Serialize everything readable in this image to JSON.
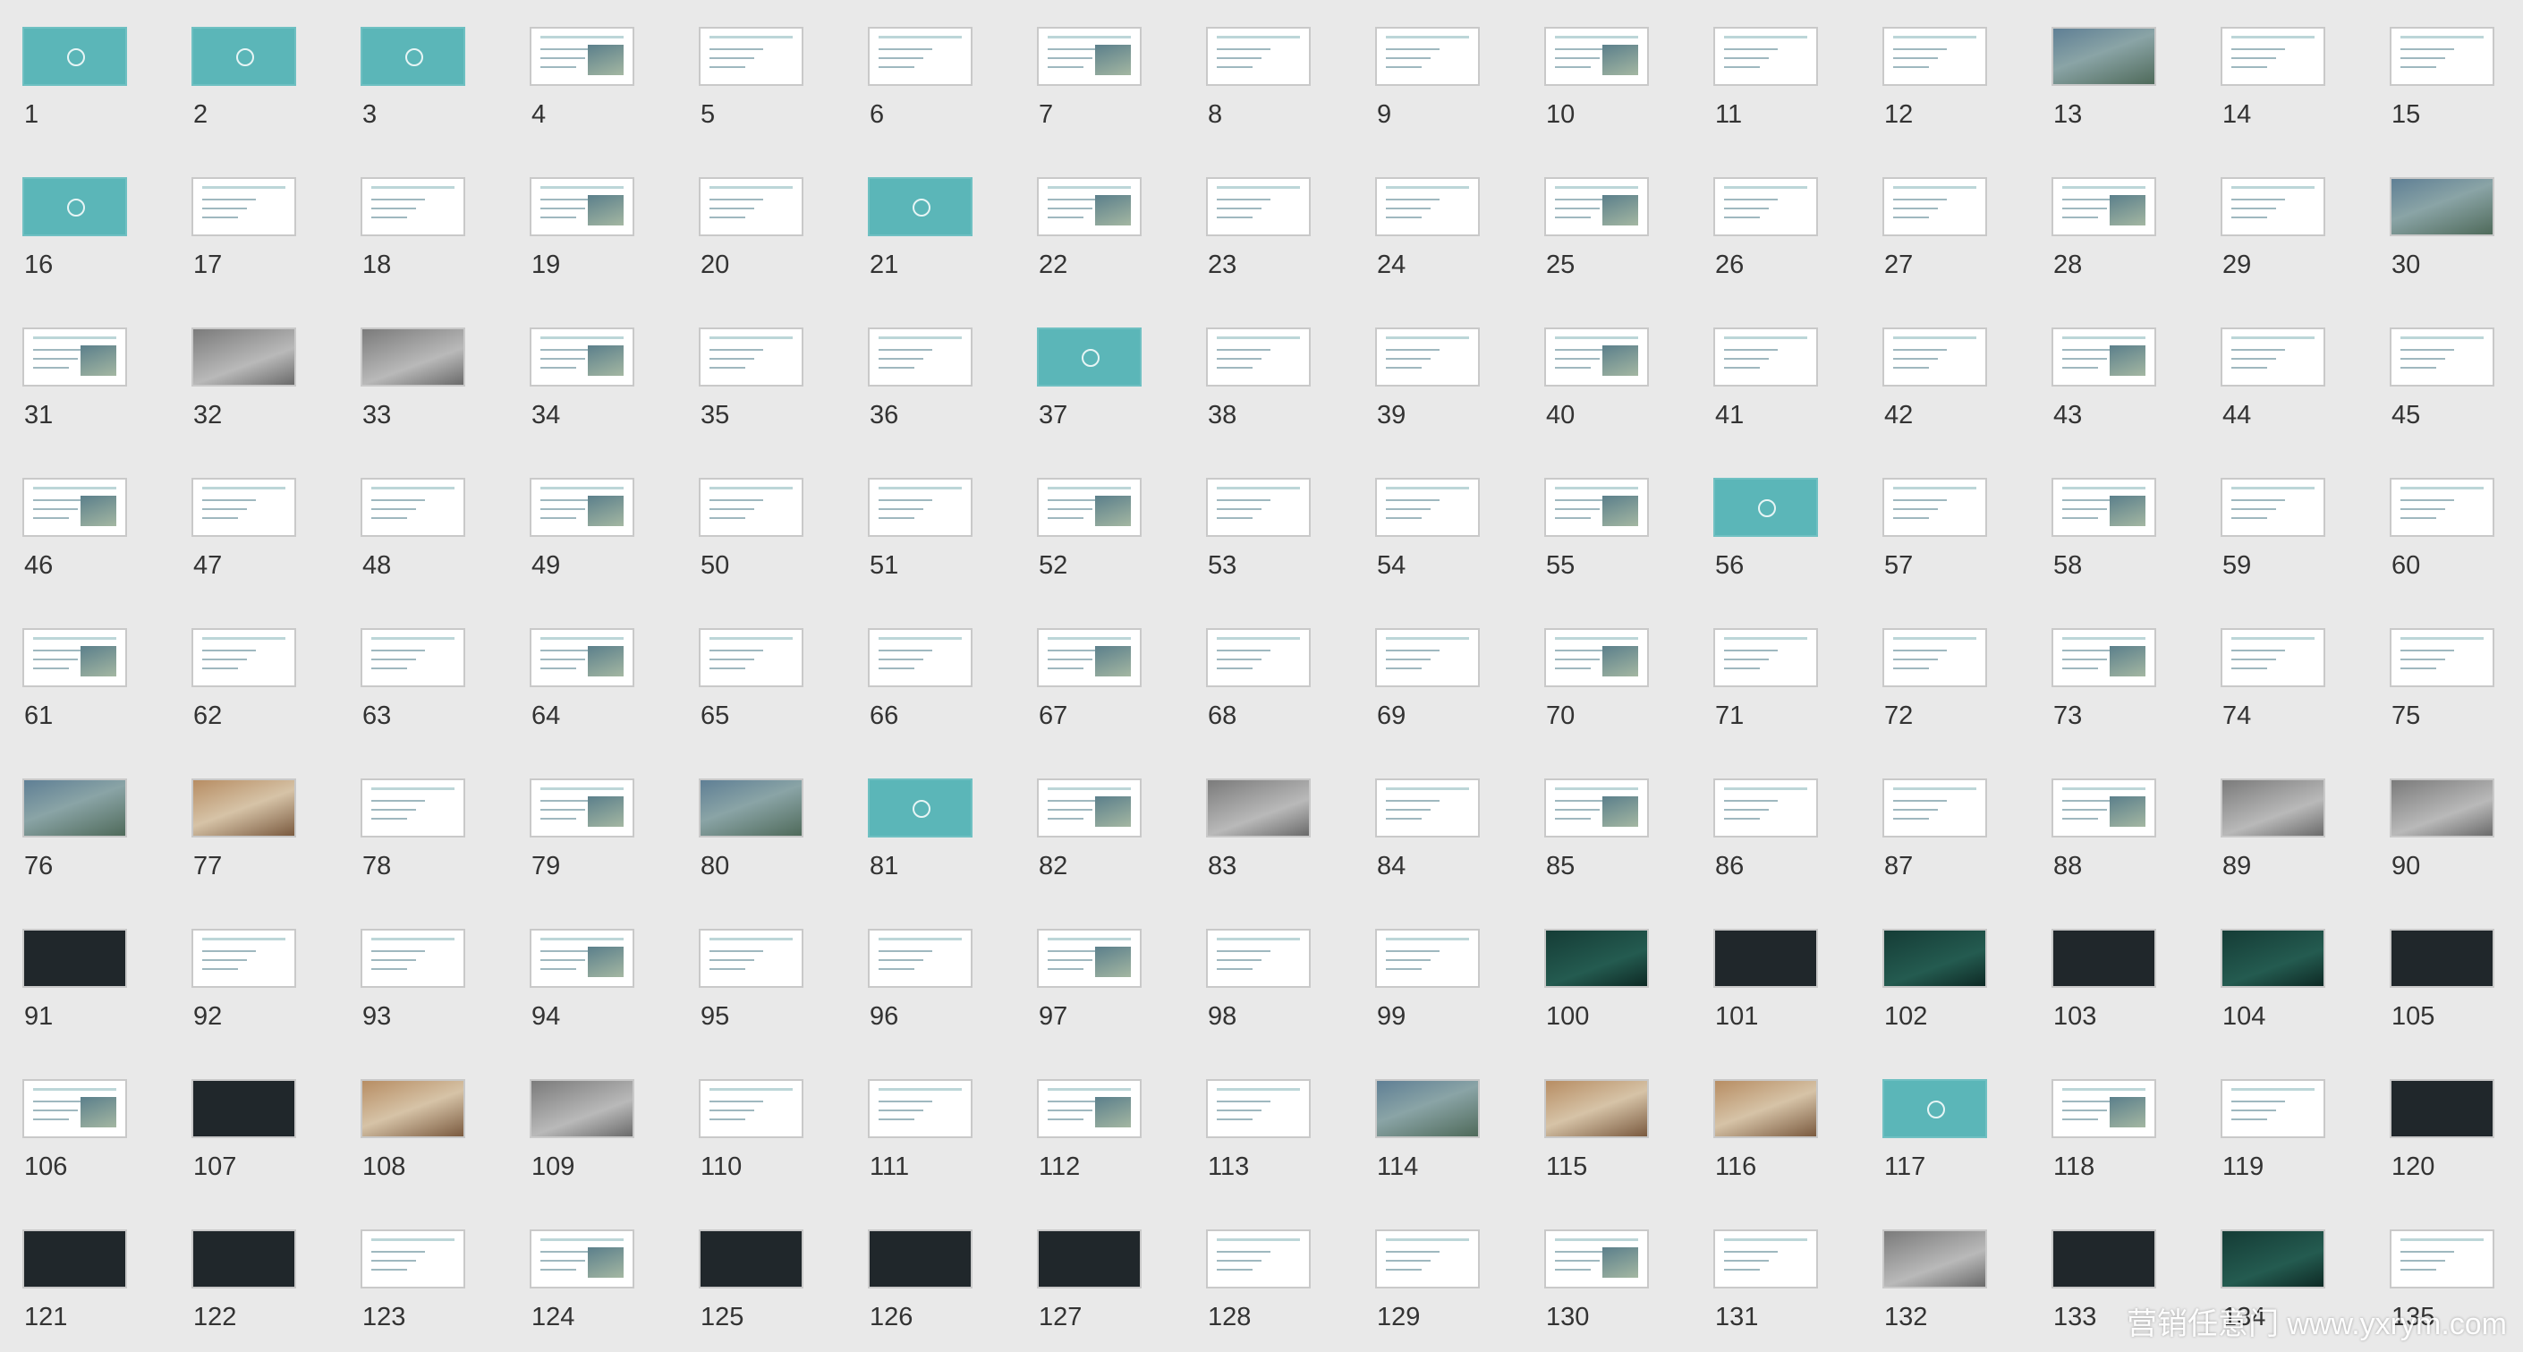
{
  "slide_sorter": {
    "slides": [
      {
        "number": "1",
        "style": "teal"
      },
      {
        "number": "2",
        "style": "teal"
      },
      {
        "number": "3",
        "style": "teal"
      },
      {
        "number": "4",
        "style": "white"
      },
      {
        "number": "5",
        "style": "white"
      },
      {
        "number": "6",
        "style": "white"
      },
      {
        "number": "7",
        "style": "white"
      },
      {
        "number": "8",
        "style": "white"
      },
      {
        "number": "9",
        "style": "white"
      },
      {
        "number": "10",
        "style": "white"
      },
      {
        "number": "11",
        "style": "white"
      },
      {
        "number": "12",
        "style": "white"
      },
      {
        "number": "13",
        "style": "photo"
      },
      {
        "number": "14",
        "style": "white"
      },
      {
        "number": "15",
        "style": "white"
      },
      {
        "number": "16",
        "style": "teal"
      },
      {
        "number": "17",
        "style": "white"
      },
      {
        "number": "18",
        "style": "white"
      },
      {
        "number": "19",
        "style": "white"
      },
      {
        "number": "20",
        "style": "white"
      },
      {
        "number": "21",
        "style": "teal"
      },
      {
        "number": "22",
        "style": "white"
      },
      {
        "number": "23",
        "style": "white"
      },
      {
        "number": "24",
        "style": "white"
      },
      {
        "number": "25",
        "style": "white"
      },
      {
        "number": "26",
        "style": "white"
      },
      {
        "number": "27",
        "style": "white"
      },
      {
        "number": "28",
        "style": "white"
      },
      {
        "number": "29",
        "style": "white"
      },
      {
        "number": "30",
        "style": "photo"
      },
      {
        "number": "31",
        "style": "white"
      },
      {
        "number": "32",
        "style": "grey"
      },
      {
        "number": "33",
        "style": "grey"
      },
      {
        "number": "34",
        "style": "white"
      },
      {
        "number": "35",
        "style": "white"
      },
      {
        "number": "36",
        "style": "white"
      },
      {
        "number": "37",
        "style": "teal"
      },
      {
        "number": "38",
        "style": "white"
      },
      {
        "number": "39",
        "style": "white"
      },
      {
        "number": "40",
        "style": "white"
      },
      {
        "number": "41",
        "style": "white"
      },
      {
        "number": "42",
        "style": "white"
      },
      {
        "number": "43",
        "style": "white"
      },
      {
        "number": "44",
        "style": "white"
      },
      {
        "number": "45",
        "style": "white"
      },
      {
        "number": "46",
        "style": "white"
      },
      {
        "number": "47",
        "style": "white"
      },
      {
        "number": "48",
        "style": "white"
      },
      {
        "number": "49",
        "style": "white"
      },
      {
        "number": "50",
        "style": "white"
      },
      {
        "number": "51",
        "style": "white"
      },
      {
        "number": "52",
        "style": "white"
      },
      {
        "number": "53",
        "style": "white"
      },
      {
        "number": "54",
        "style": "white"
      },
      {
        "number": "55",
        "style": "white"
      },
      {
        "number": "56",
        "style": "teal"
      },
      {
        "number": "57",
        "style": "white"
      },
      {
        "number": "58",
        "style": "white"
      },
      {
        "number": "59",
        "style": "white"
      },
      {
        "number": "60",
        "style": "white"
      },
      {
        "number": "61",
        "style": "white"
      },
      {
        "number": "62",
        "style": "white"
      },
      {
        "number": "63",
        "style": "white"
      },
      {
        "number": "64",
        "style": "white"
      },
      {
        "number": "65",
        "style": "white"
      },
      {
        "number": "66",
        "style": "white"
      },
      {
        "number": "67",
        "style": "white"
      },
      {
        "number": "68",
        "style": "white"
      },
      {
        "number": "69",
        "style": "white"
      },
      {
        "number": "70",
        "style": "white"
      },
      {
        "number": "71",
        "style": "white"
      },
      {
        "number": "72",
        "style": "white"
      },
      {
        "number": "73",
        "style": "white"
      },
      {
        "number": "74",
        "style": "white"
      },
      {
        "number": "75",
        "style": "white"
      },
      {
        "number": "76",
        "style": "photo"
      },
      {
        "number": "77",
        "style": "warm"
      },
      {
        "number": "78",
        "style": "white"
      },
      {
        "number": "79",
        "style": "white"
      },
      {
        "number": "80",
        "style": "photo"
      },
      {
        "number": "81",
        "style": "teal"
      },
      {
        "number": "82",
        "style": "white"
      },
      {
        "number": "83",
        "style": "grey"
      },
      {
        "number": "84",
        "style": "white"
      },
      {
        "number": "85",
        "style": "white"
      },
      {
        "number": "86",
        "style": "white"
      },
      {
        "number": "87",
        "style": "white"
      },
      {
        "number": "88",
        "style": "white"
      },
      {
        "number": "89",
        "style": "grey"
      },
      {
        "number": "90",
        "style": "grey"
      },
      {
        "number": "91",
        "style": "dark"
      },
      {
        "number": "92",
        "style": "white"
      },
      {
        "number": "93",
        "style": "white"
      },
      {
        "number": "94",
        "style": "white"
      },
      {
        "number": "95",
        "style": "white"
      },
      {
        "number": "96",
        "style": "white"
      },
      {
        "number": "97",
        "style": "white"
      },
      {
        "number": "98",
        "style": "white"
      },
      {
        "number": "99",
        "style": "white"
      },
      {
        "number": "100",
        "style": "green"
      },
      {
        "number": "101",
        "style": "dark"
      },
      {
        "number": "102",
        "style": "green"
      },
      {
        "number": "103",
        "style": "dark"
      },
      {
        "number": "104",
        "style": "green"
      },
      {
        "number": "105",
        "style": "dark"
      },
      {
        "number": "106",
        "style": "white"
      },
      {
        "number": "107",
        "style": "dark"
      },
      {
        "number": "108",
        "style": "warm"
      },
      {
        "number": "109",
        "style": "grey"
      },
      {
        "number": "110",
        "style": "white"
      },
      {
        "number": "111",
        "style": "white"
      },
      {
        "number": "112",
        "style": "white"
      },
      {
        "number": "113",
        "style": "white"
      },
      {
        "number": "114",
        "style": "photo"
      },
      {
        "number": "115",
        "style": "warm"
      },
      {
        "number": "116",
        "style": "warm"
      },
      {
        "number": "117",
        "style": "teal"
      },
      {
        "number": "118",
        "style": "white"
      },
      {
        "number": "119",
        "style": "white"
      },
      {
        "number": "120",
        "style": "dark"
      },
      {
        "number": "121",
        "style": "dark"
      },
      {
        "number": "122",
        "style": "dark"
      },
      {
        "number": "123",
        "style": "white"
      },
      {
        "number": "124",
        "style": "white"
      },
      {
        "number": "125",
        "style": "dark"
      },
      {
        "number": "126",
        "style": "dark"
      },
      {
        "number": "127",
        "style": "dark"
      },
      {
        "number": "128",
        "style": "white"
      },
      {
        "number": "129",
        "style": "white"
      },
      {
        "number": "130",
        "style": "white"
      },
      {
        "number": "131",
        "style": "white"
      },
      {
        "number": "132",
        "style": "grey"
      },
      {
        "number": "133",
        "style": "dark"
      },
      {
        "number": "134",
        "style": "green"
      },
      {
        "number": "135",
        "style": "white"
      }
    ]
  },
  "watermark": {
    "text": "营销任意门 www.yxrym.com"
  }
}
